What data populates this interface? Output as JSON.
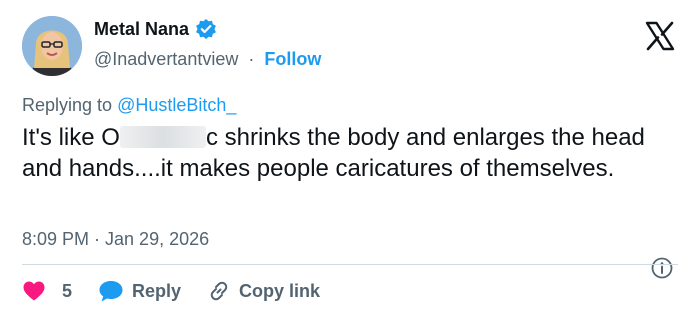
{
  "author": {
    "display_name": "Metal Nana",
    "handle": "@Inadvertantview",
    "separator": "·",
    "follow_label": "Follow"
  },
  "reply_to": {
    "prefix": "Replying to",
    "mention": "@HustleBitch_"
  },
  "tweet": {
    "text_before_blur": "It's like O",
    "text_after_blur": "c shrinks the body and enlarges the head and hands....it makes people caricatures of themselves."
  },
  "timestamp": "8:09 PM · Jan 29, 2026",
  "actions": {
    "like_count": "5",
    "reply_label": "Reply",
    "copy_link_label": "Copy link"
  },
  "colors": {
    "accent": "#1d9bf0",
    "like": "#f91880",
    "muted": "#536471",
    "text": "#0f1419"
  },
  "icons": {
    "verified": "verified-badge-icon",
    "logo": "x-logo-icon",
    "info": "info-icon",
    "like": "heart-icon",
    "reply": "speech-bubble-icon",
    "link": "link-icon"
  }
}
